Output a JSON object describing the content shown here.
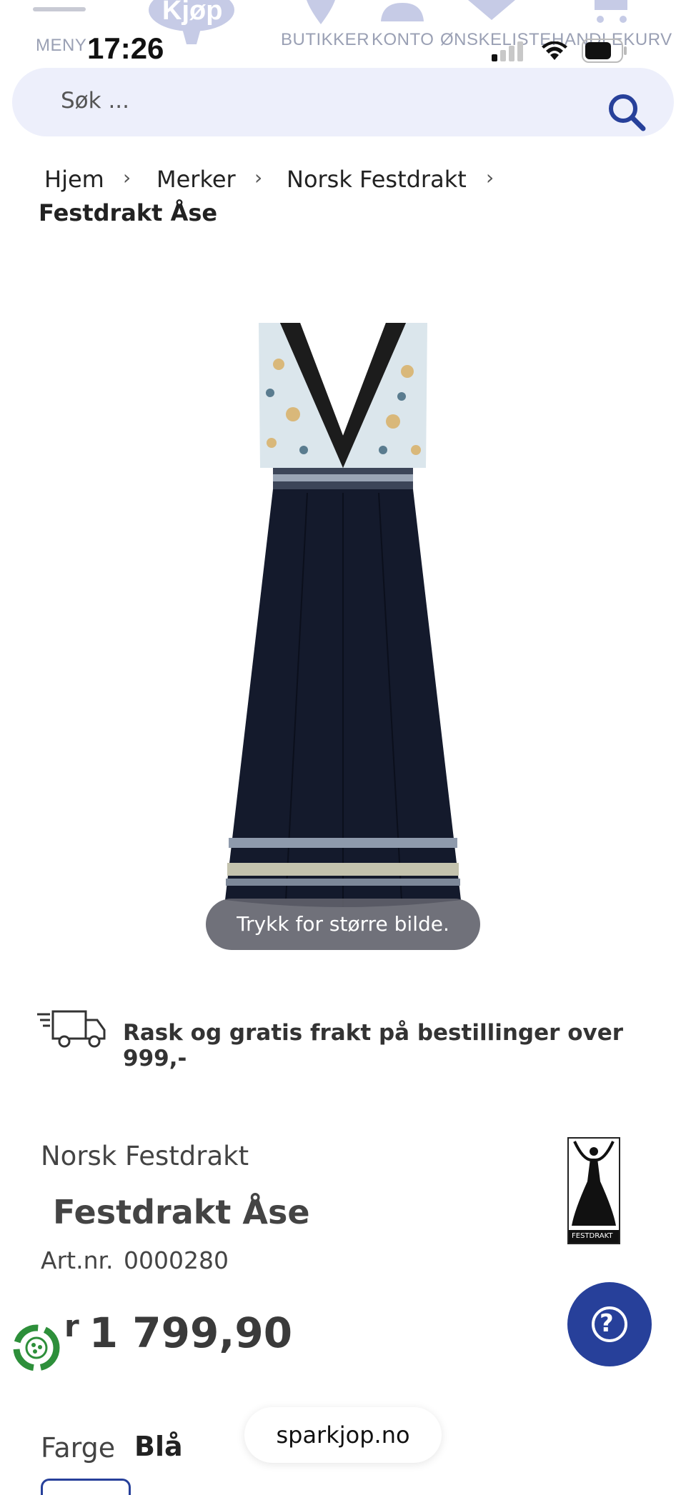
{
  "status_bar": {
    "time": "17:26"
  },
  "nav": {
    "menu_label": "MENY",
    "logo_text": "Kjøp",
    "items": [
      {
        "label": "BUTIKKER",
        "icon": "map-pin-icon"
      },
      {
        "label": "KONTO",
        "icon": "user-icon"
      },
      {
        "label": "ØNSKELISTE",
        "icon": "heart-icon"
      },
      {
        "label": "HANDLEKURV",
        "icon": "cart-icon"
      }
    ]
  },
  "search": {
    "placeholder": "Søk ..."
  },
  "breadcrumb": {
    "items": [
      "Hjem",
      "Merker",
      "Norsk Festdrakt"
    ],
    "separator": "›",
    "current": "Festdrakt Åse"
  },
  "image": {
    "caption": "Trykk for større bilde."
  },
  "shipping": {
    "text": "Rask og gratis frakt på bestillinger over 999,-"
  },
  "product": {
    "brand": "Norsk Festdrakt",
    "title": "Festdrakt Åse",
    "art_label": "Art.nr.",
    "art_number": "0000280",
    "price_prefix": "r",
    "price": "1 799,90",
    "color_label": "Farge",
    "color_value": "Blå",
    "brand_logo_text": "FESTDRAKT"
  },
  "help_button": {
    "symbol": "?"
  },
  "site_pill": {
    "text": "sparkjop.no"
  },
  "colors": {
    "accent": "#27409a",
    "search_bg": "#edeffb",
    "nav_faded": "#c6cbe6"
  }
}
